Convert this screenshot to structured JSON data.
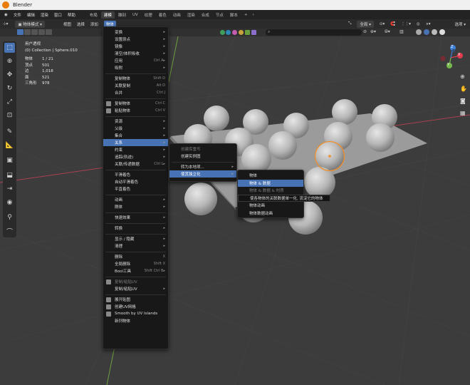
{
  "app": {
    "title": "Blender"
  },
  "topmenu": [
    "文件",
    "编辑",
    "渲染",
    "窗口",
    "帮助"
  ],
  "workspaces": [
    "布局",
    "建模",
    "雕刻",
    "UV",
    "纹理",
    "着色",
    "动画",
    "渲染",
    "合成",
    "节点",
    "脚本",
    "+"
  ],
  "active_workspace": 1,
  "header": {
    "mode": "物体模式",
    "menus": [
      "视图",
      "选择",
      "添加",
      "物体"
    ],
    "active_menu": 3,
    "transform": "全局",
    "search_placeholder": ""
  },
  "viewport_info": {
    "view": "用户透视",
    "collection": "(0) Collection | Sphere.010",
    "stats": [
      {
        "k": "物体",
        "v": "1 / 21"
      },
      {
        "k": "顶点",
        "v": "501"
      },
      {
        "k": "边",
        "v": "1,018"
      },
      {
        "k": "面",
        "v": "521"
      },
      {
        "k": "三角形",
        "v": "978"
      }
    ]
  },
  "object_menu": [
    {
      "label": "变换",
      "arrow": true
    },
    {
      "label": "设置原点",
      "arrow": true
    },
    {
      "label": "镜像",
      "arrow": true
    },
    {
      "label": "清空/体积吸收",
      "arrow": true
    },
    {
      "label": "应用",
      "shortcut": "Ctrl A▸"
    },
    {
      "label": "吸附",
      "arrow": true
    },
    {
      "sep": true
    },
    {
      "label": "复制物体",
      "shortcut": "Shift D"
    },
    {
      "label": "关联复制",
      "shortcut": "Alt D"
    },
    {
      "label": "合并",
      "shortcut": "Ctrl J"
    },
    {
      "sep": true
    },
    {
      "label": "复制物体",
      "shortcut": "Ctrl C",
      "icon": true
    },
    {
      "label": "粘贴物体",
      "shortcut": "Ctrl V",
      "icon": true
    },
    {
      "sep": true
    },
    {
      "label": "资源",
      "arrow": true
    },
    {
      "label": "父级",
      "arrow": true
    },
    {
      "label": "集合",
      "arrow": true
    },
    {
      "label": "关系",
      "arrow": true,
      "hl": true
    },
    {
      "label": "约束",
      "arrow": true
    },
    {
      "label": "追踪(轨迹)",
      "arrow": true
    },
    {
      "label": "关联/传递数据",
      "shortcut": "Ctrl L▸"
    },
    {
      "sep": true
    },
    {
      "label": "平滑着色"
    },
    {
      "label": "自动平滑着色"
    },
    {
      "label": "平直着色"
    },
    {
      "sep": true
    },
    {
      "label": "动画",
      "arrow": true
    },
    {
      "label": "刚体",
      "arrow": true
    },
    {
      "sep": true
    },
    {
      "label": "快速效果",
      "arrow": true
    },
    {
      "sep": true
    },
    {
      "label": "转换",
      "arrow": true
    },
    {
      "sep": true
    },
    {
      "label": "显示 / 隐藏",
      "arrow": true
    },
    {
      "label": "清理",
      "arrow": true
    },
    {
      "sep": true
    },
    {
      "label": "删除",
      "shortcut": "X"
    },
    {
      "label": "全局删除",
      "shortcut": "Shift X"
    },
    {
      "label": "Bool工具",
      "shortcut": "Shift Ctrl B▸"
    },
    {
      "sep": true
    },
    {
      "label": "复制/粘贴UV",
      "dim": true,
      "icon": true
    },
    {
      "label": "复制/粘贴UV",
      "arrow": true
    },
    {
      "sep": true
    },
    {
      "label": "展开贴图",
      "icon": true
    },
    {
      "label": "创建UV网格",
      "icon": true
    },
    {
      "label": "Smooth by UV Islands",
      "icon": true
    },
    {
      "label": "新列物体"
    }
  ],
  "relations_menu": [
    {
      "label": "创建库重写",
      "dim": true
    },
    {
      "label": "创建实例图"
    },
    {
      "sep": true
    },
    {
      "label": "转为本地项...",
      "arrow": true
    },
    {
      "label": "使其独立化",
      "arrow": true,
      "hl": true
    }
  ],
  "single_user_menu": [
    {
      "label": "物体"
    },
    {
      "label": "物体 & 数据",
      "hl": true
    },
    {
      "label": "物体 & 数据 & 材质",
      "dim": true
    },
    {
      "label": "使各物体的关联数据单一化, 流淀它的物体",
      "tooltip": true
    },
    {
      "label": "物体动画"
    },
    {
      "label": "物体数据动画"
    }
  ],
  "colors": {
    "accent": "#4772b3",
    "selection": "#f0902c",
    "axis_x": "#e03b4e",
    "axis_y": "#76b94c",
    "axis_z": "#3f7fd6"
  },
  "gizmo": {
    "x": "X",
    "y": "Y",
    "z": "Z"
  }
}
